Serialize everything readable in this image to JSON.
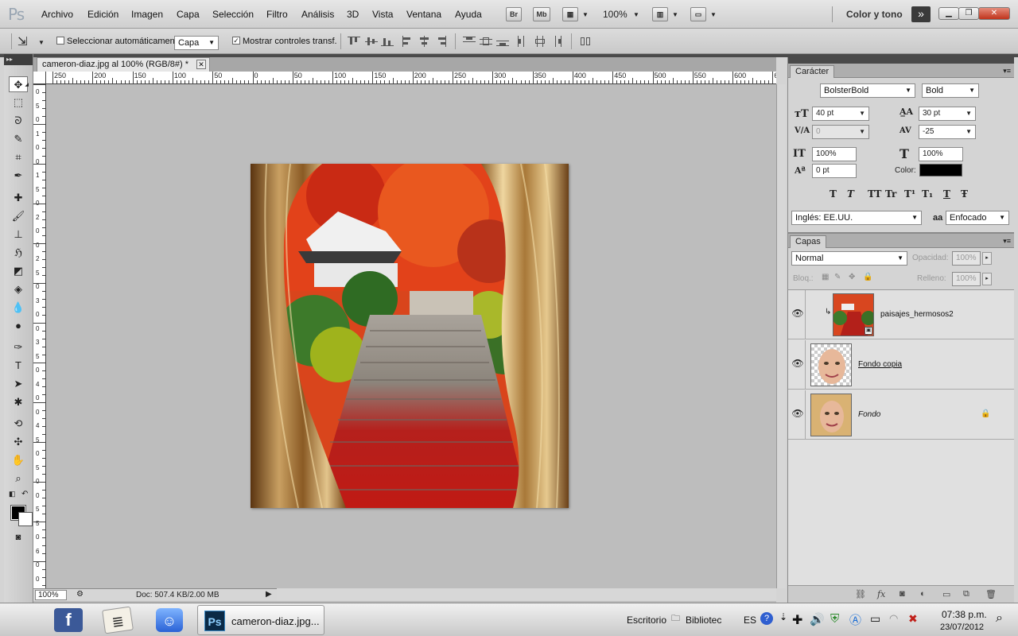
{
  "app": {
    "logo": "Ps",
    "zoom": "100%",
    "workspace": "Color y tono",
    "badges": [
      "Br",
      "Mb"
    ]
  },
  "menu": [
    "Archivo",
    "Edición",
    "Imagen",
    "Capa",
    "Selección",
    "Filtro",
    "Análisis",
    "3D",
    "Vista",
    "Ventana",
    "Ayuda"
  ],
  "options": {
    "auto_select_label": "Seleccionar automáticamente:",
    "auto_select_target": "Capa",
    "show_transform_label": "Mostrar controles transf.",
    "show_transform_checked": true
  },
  "document": {
    "tab_title": "cameron-diaz.jpg al 100% (RGB/8#) *",
    "zoom": "100%",
    "doc_info": "Doc: 507.4 KB/2.00 MB"
  },
  "ruler": {
    "h_labels": [
      "250",
      "200",
      "150",
      "100",
      "50",
      "0",
      "50",
      "100",
      "150",
      "200",
      "250",
      "300",
      "350",
      "400",
      "450",
      "500",
      "550",
      "600",
      "65"
    ],
    "v_labels": [
      "0",
      "5",
      "0",
      "1",
      "0",
      "0",
      "1",
      "5",
      "0",
      "2",
      "0",
      "0",
      "2",
      "5",
      "0",
      "3",
      "0",
      "0",
      "3",
      "5",
      "0",
      "4",
      "0",
      "0",
      "4",
      "5",
      "0",
      "5",
      "0",
      "0",
      "5",
      "5",
      "0",
      "6",
      "0",
      "0"
    ]
  },
  "character_panel": {
    "tab": "Carácter",
    "font_family": "BolsterBold",
    "font_style": "Bold",
    "size": "40 pt",
    "leading": "30 pt",
    "kerning": "0",
    "tracking": "-25",
    "vertical_scale": "100%",
    "horizontal_scale": "100%",
    "baseline_shift": "0 pt",
    "color_label": "Color:",
    "color": "#000000",
    "format_buttons": [
      "T",
      "T",
      "TT",
      "Tr",
      "T¹",
      "T₁",
      "T",
      "Ŧ"
    ],
    "language": "Inglés: EE.UU.",
    "aa_icon": "aa",
    "antialias": "Enfocado"
  },
  "layers_panel": {
    "tab": "Capas",
    "blend_mode": "Normal",
    "opacity_label": "Opacidad:",
    "opacity": "100%",
    "lock_label": "Bloq.:",
    "fill_label": "Relleno:",
    "fill": "100%",
    "layers": [
      {
        "name": "paisajes_hermosos2",
        "visible": true,
        "clipped": true
      },
      {
        "name": "Fondo copia",
        "visible": true
      },
      {
        "name": "Fondo",
        "visible": true,
        "locked": true
      }
    ]
  },
  "taskbar": {
    "active_app_label": "cameron-diaz.jpg...",
    "desktop_label": "Escritorio",
    "library_label": "Bibliotec",
    "language": "ES",
    "time": "07:38 p.m.",
    "date": "23/07/2012"
  }
}
